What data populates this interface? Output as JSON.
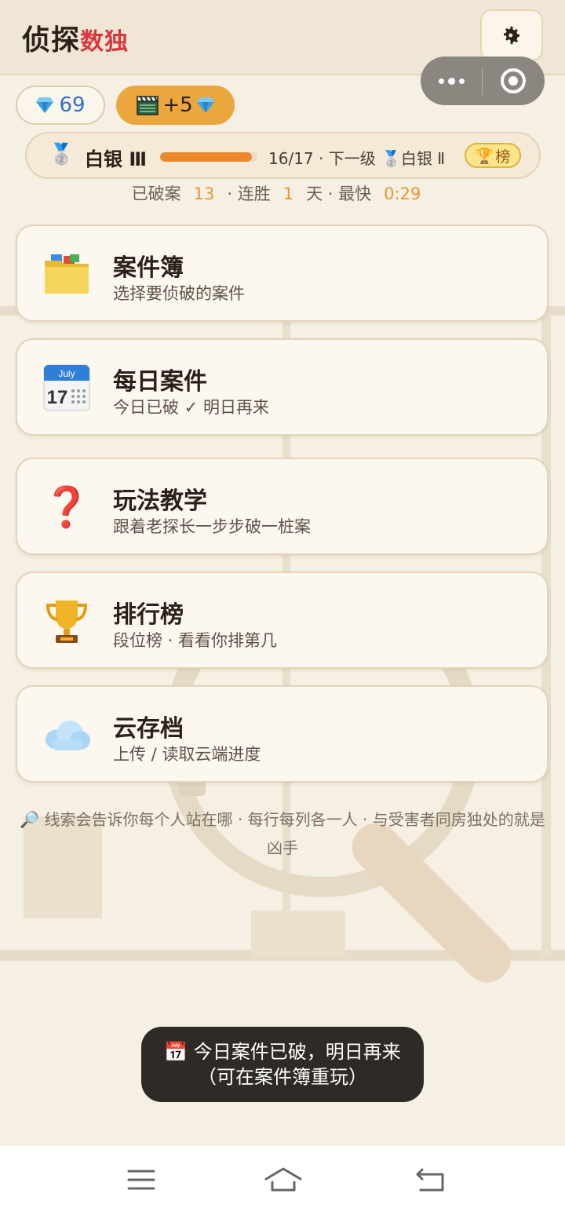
{
  "header": {
    "title_part1": "侦探",
    "title_part2": "数独",
    "settings_icon": "gear-icon"
  },
  "currency": {
    "gems": "69",
    "ad_reward": "+5"
  },
  "rank": {
    "name": "白银 Ⅲ",
    "progress_text": "16/17 · 下一级",
    "progress_fraction": 0.94,
    "next_rank": "白银 Ⅱ",
    "board_label": "榜"
  },
  "stats": {
    "solved_label": "已破案",
    "solved": "13",
    "streak_label": "· 连胜",
    "streak": "1",
    "fastest_label": "天 · 最快",
    "fastest": "0:29"
  },
  "menu": [
    {
      "title": "案件簿",
      "subtitle": "选择要侦破的案件",
      "icon": "folder-icon"
    },
    {
      "title": "每日案件",
      "subtitle": "今日已破 ✓ 明日再来",
      "icon": "calendar-icon",
      "calendar_month": "July",
      "calendar_day": "17"
    },
    {
      "title": "玩法教学",
      "subtitle": "跟着老探长一步步破一桩案",
      "icon": "question-icon",
      "glyph": "❓"
    },
    {
      "title": "排行榜",
      "subtitle": "段位榜 · 看看你排第几",
      "icon": "trophy-icon"
    },
    {
      "title": "云存档",
      "subtitle": "上传 / 读取云端进度",
      "icon": "cloud-icon"
    }
  ],
  "hint": "🔎 线索会告诉你每个人站在哪 · 每行每列各一人 · 与受害者同房独处的就是凶手",
  "toast": "📅 今日案件已破，明日再来（可在案件簿重玩）",
  "colors": {
    "accent_orange": "#eba63d",
    "title_red": "#d9363e",
    "gem_blue": "#2e6fc4",
    "background": "#f6efe3"
  }
}
